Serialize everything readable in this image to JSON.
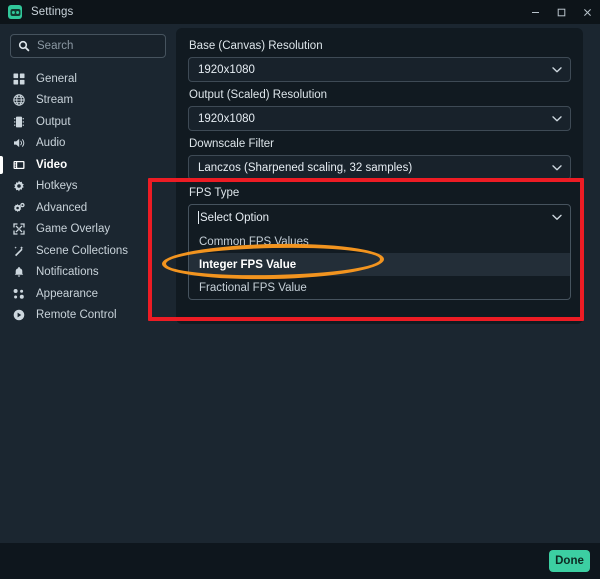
{
  "window": {
    "title": "Settings",
    "app_icon": "obs-studio-icon",
    "controls": [
      {
        "name": "minimize-button",
        "glyph": "minimize-icon"
      },
      {
        "name": "maximize-button",
        "glyph": "maximize-icon"
      },
      {
        "name": "close-button",
        "glyph": "close-icon"
      }
    ]
  },
  "search": {
    "placeholder": "Search",
    "value": "",
    "icon": "search-icon"
  },
  "sidebar": {
    "items": [
      {
        "label": "General",
        "icon": "grid-icon",
        "active": false
      },
      {
        "label": "Stream",
        "icon": "globe-icon",
        "active": false
      },
      {
        "label": "Output",
        "icon": "chip-icon",
        "active": false
      },
      {
        "label": "Audio",
        "icon": "speaker-icon",
        "active": false
      },
      {
        "label": "Video",
        "icon": "film-icon",
        "active": true
      },
      {
        "label": "Hotkeys",
        "icon": "gear-icon",
        "active": false
      },
      {
        "label": "Advanced",
        "icon": "gears-icon",
        "active": false
      },
      {
        "label": "Game Overlay",
        "icon": "expand-icon",
        "active": false
      },
      {
        "label": "Scene Collections",
        "icon": "wand-icon",
        "active": false
      },
      {
        "label": "Notifications",
        "icon": "bell-icon",
        "active": false
      },
      {
        "label": "Appearance",
        "icon": "dots-icon",
        "active": false
      },
      {
        "label": "Remote Control",
        "icon": "play-circle-icon",
        "active": false
      }
    ]
  },
  "main": {
    "fields": [
      {
        "label": "Base (Canvas) Resolution",
        "value": "1920x1080"
      },
      {
        "label": "Output (Scaled) Resolution",
        "value": "1920x1080"
      },
      {
        "label": "Downscale Filter",
        "value": "Lanczos (Sharpened scaling, 32 samples)"
      }
    ],
    "fps": {
      "label": "FPS Type",
      "selected_value": "Select Option",
      "options": [
        {
          "label": "Common FPS Values",
          "highlighted": false
        },
        {
          "label": "Integer FPS Value",
          "highlighted": true
        },
        {
          "label": "Fractional FPS Value",
          "highlighted": false
        }
      ]
    }
  },
  "footer": {
    "done_label": "Done"
  },
  "annotations": {
    "red_box_color": "#ED1C24",
    "orange_ellipse_color": "#F2941F",
    "accent_color": "#3CCFA2"
  }
}
